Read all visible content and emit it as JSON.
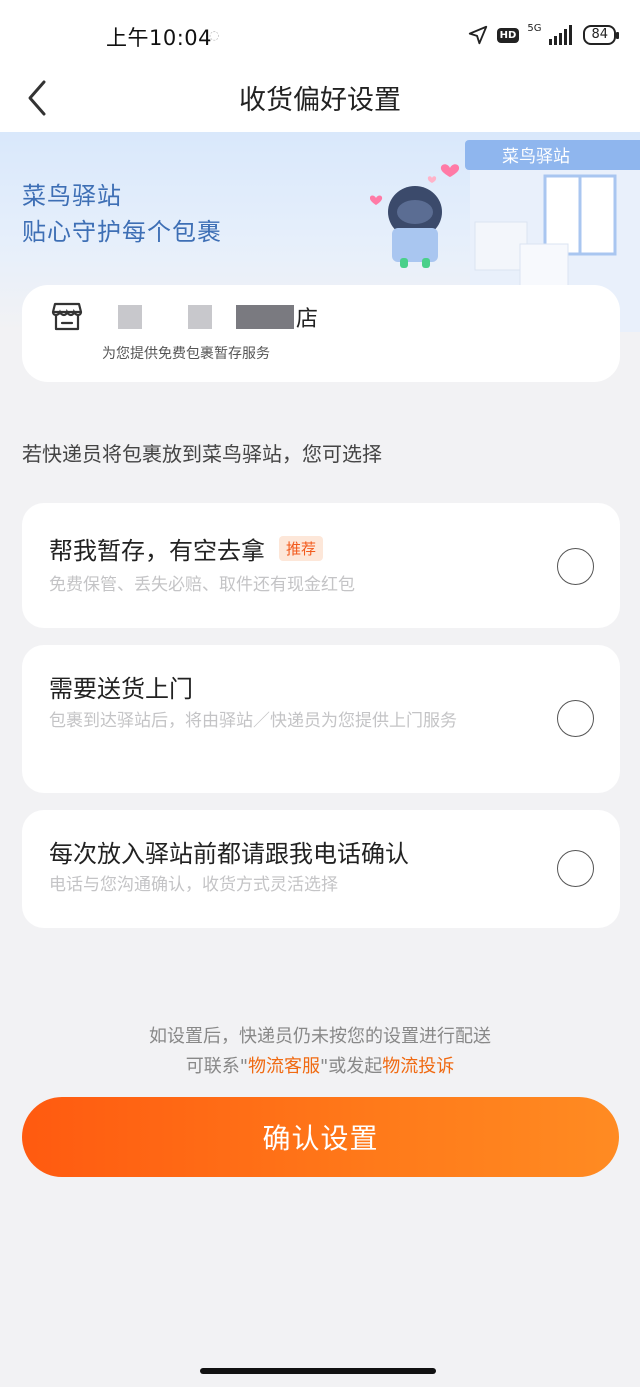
{
  "status_bar": {
    "time": "上午10:04",
    "hd": "HD",
    "network": "5G",
    "battery": "84"
  },
  "nav": {
    "title": "收货偏好设置"
  },
  "banner": {
    "line1": "菜鸟驿站",
    "line2": "贴心守护每个包裹",
    "sign_text": "菜鸟驿站"
  },
  "station": {
    "name_suffix": "店",
    "subtitle": "为您提供免费包裹暂存服务"
  },
  "prompt": "若快递员将包裹放到菜鸟驿站，您可选择",
  "options": [
    {
      "title": "帮我暂存，有空去拿",
      "badge": "推荐",
      "desc": "免费保管、丢失必赔、取件还有现金红包"
    },
    {
      "title": "需要送货上门",
      "desc": "包裹到达驿站后，将由驿站／快递员为您提供上门服务"
    },
    {
      "title": "每次放入驿站前都请跟我电话确认",
      "desc": "电话与您沟通确认，收货方式灵活选择"
    }
  ],
  "footer": {
    "note_line1": "如设置后，快递员仍未按您的设置进行配送",
    "note_prefix": "可联系\"",
    "link_service": "物流客服",
    "note_middle": "\"或发起",
    "link_complaint": "物流投诉"
  },
  "confirm_label": "确认设置",
  "colors": {
    "accent": "#ff6a10",
    "banner_text": "#3e6fb5",
    "badge_bg": "#fde7d9"
  }
}
